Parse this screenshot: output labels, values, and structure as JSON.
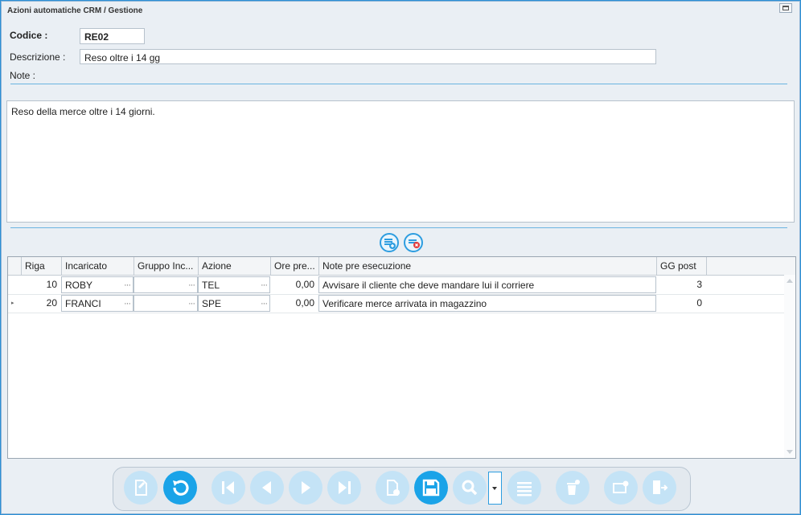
{
  "window": {
    "title": "Azioni automatiche CRM / Gestione"
  },
  "form": {
    "codice_label": "Codice :",
    "codice_value": "RE02",
    "descrizione_label": "Descrizione :",
    "descrizione_value": "Reso oltre i 14 gg",
    "note_label": "Note :",
    "note_text": "Reso della merce oltre i 14 giorni."
  },
  "grid": {
    "columns": [
      "Riga",
      "Incaricato",
      "Gruppo Inc...",
      "Azione",
      "Ore pre...",
      "Note pre esecuzione",
      "GG post"
    ],
    "rows": [
      {
        "riga": "10",
        "incaricato": "ROBY",
        "gruppo": "",
        "azione": "TEL",
        "ore": "0,00",
        "note": "Avvisare il cliente che deve mandare lui il corriere",
        "gg": "3"
      },
      {
        "riga": "20",
        "incaricato": "FRANCI",
        "gruppo": "",
        "azione": "SPE",
        "ore": "0,00",
        "note": "Verificare merce arrivata in magazzino",
        "gg": "0"
      }
    ],
    "ellipsis": "···",
    "row_indicator": "▸"
  },
  "row_buttons": {
    "add_icon": "add-row-icon",
    "remove_icon": "remove-row-icon"
  },
  "toolbar": {
    "buttons": [
      "new-icon",
      "undo-icon",
      "first-icon",
      "prev-icon",
      "next-icon",
      "last-icon",
      "duplicate-icon",
      "save-icon",
      "search-icon",
      "list-icon",
      "delete-icon",
      "print-icon",
      "exit-icon"
    ],
    "accent": "#1aa3e8",
    "disabled": "#c4e3f6"
  }
}
